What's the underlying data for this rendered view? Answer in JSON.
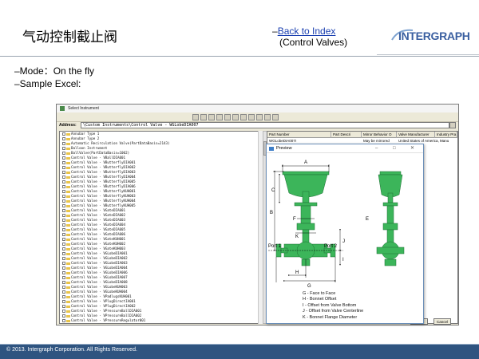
{
  "slide": {
    "title": "气动控制截止阀",
    "back_prefix": "–",
    "back_link": "Back to Index",
    "back_sub": "(Control Valves)",
    "logo_text": "INTERGRAPH",
    "bullet_mode": "–Mode：On the fly",
    "bullet_excel": "–Sample Excel:",
    "footer": "© 2013. Intergraph Corporation. All Rights Reserved."
  },
  "window": {
    "title": "Select Instrument",
    "address_label": "Address:",
    "address_value": "\\Custom Instruments\\Control Valve - WGLobeDIA007",
    "tree_items": [
      "Annubar Type 1",
      "Annubar Type 2",
      "Automatic Recirculation Valve(PartDataBasis=2143)",
      "Balloon Instrument",
      "BallValve(PartDataBasis=1002)",
      "Control Valve - VBallDIA001",
      "Control Valve - VButterflyDIA001",
      "Control Valve - VButterflyDIA002",
      "Control Valve - VButterflyDIA003",
      "Control Valve - VButterflyDIA004",
      "Control Valve - VButterflyDIA005",
      "Control Valve - VButterflyDIA006",
      "Control Valve - VButterflyKUH001",
      "Control Valve - VButterflyKUH003",
      "Control Valve - VButterflyKUH004",
      "Control Valve - VButterflyKUH005",
      "Control Valve - VGateDIA001",
      "Control Valve - VGateDIA002",
      "Control Valve - VGateDIA003",
      "Control Valve - VGateDIA004",
      "Control Valve - VGateDIA005",
      "Control Valve - VGateDIA006",
      "Control Valve - VGateKUH001",
      "Control Valve - VGateKUH002",
      "Control Valve - VGateKUH003",
      "Control Valve - VGLobeDIA001",
      "Control Valve - VGLobeDIA002",
      "Control Valve - VGLobeDIA003",
      "Control Valve - VGLobeDIA004",
      "Control Valve - VGLobeDIA006",
      "Control Valve - VGLobeDIA007",
      "Control Valve - VGLobeDIA008",
      "Control Valve - VGLobeKUH003",
      "Control Valve - VGLobeKUH004",
      "Control Valve - VPadlugsKUH001",
      "Control Valve - VPlugDirectIA001",
      "Control Valve - VPlugDirectIA002",
      "Control Valve - VPressureBallDIA001",
      "Control Valve - VPressureBallDIA002",
      "Control Valve - VPressureRegulator001",
      "Control Valve - VPressureRegulator002",
      "Control Valve - VPressureRegulator003",
      "Control Valve - VPressureRegulator004"
    ],
    "columns": [
      "Part Number",
      "Part Descri",
      "Mirror Behavior O",
      "Valve Manufacturer",
      "Industry Pra"
    ],
    "row": [
      "WGLobeDIA007I",
      "",
      "May be mirrored",
      "United States of America, Manu",
      ""
    ],
    "ok_label": "OK",
    "cancel_label": "Cancel"
  },
  "preview": {
    "title": "Preview",
    "min_glyph": "–",
    "max_glyph": "□",
    "close_glyph": "✕",
    "dims": [
      "A",
      "B",
      "C",
      "F",
      "E",
      "K",
      "J",
      "I",
      "H",
      "G"
    ],
    "port1": "Port 1",
    "port2": "Port 2",
    "legend": [
      "G - Face to Face",
      "H - Bonnet Offset",
      "I - Offset from Valve Bottom",
      "J - Offset from Valve Centerline",
      "K - Bonnet Flange Diameter"
    ]
  },
  "colors": {
    "valve_green": "#3cb55a",
    "footer_blue": "#2f5480",
    "link_blue": "#1a3fb0",
    "logo_blue": "#3a5fa0"
  }
}
